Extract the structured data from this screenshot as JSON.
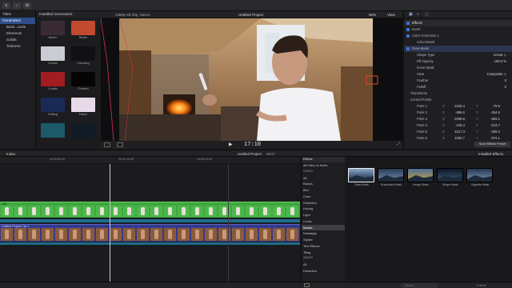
{
  "toolbar": {
    "buttons": [
      "≡",
      "↓",
      "⚙"
    ]
  },
  "libraries": {
    "items": [
      {
        "label": "Titles",
        "selected": false
      },
      {
        "label": "Generators",
        "selected": true
      },
      {
        "label": "Back...unds",
        "selected": false
      },
      {
        "label": "Elements",
        "selected": false
      },
      {
        "label": "Solids",
        "selected": false
      },
      {
        "label": "Textures",
        "selected": false
      }
    ]
  },
  "browser": {
    "title": "Installed Generators",
    "thumbs": [
      {
        "label": "Bokeh",
        "color": "#3a2a34"
      },
      {
        "label": "Bricks",
        "color": "#c24a2e"
      },
      {
        "label": "Clouds",
        "color": "#c9ccd2"
      },
      {
        "label": "Counting",
        "color": "#111114"
      },
      {
        "label": "Curtain",
        "color": "#a31c22"
      },
      {
        "label": "Custom",
        "color": "#050506"
      },
      {
        "label": "Drifting",
        "color": "#1a2a55"
      },
      {
        "label": "Fabric",
        "color": "#e6d9e8"
      },
      {
        "label": "",
        "color": "#1c5a6a"
      },
      {
        "label": "",
        "color": "#121a25"
      }
    ]
  },
  "viewer": {
    "format": "1080p HD 30p, Stereo",
    "project": "Untitled Project",
    "zoom": "50%",
    "view_label": "View",
    "timecode": "17:10"
  },
  "inspector": {
    "sections": [
      {
        "label": "Effects",
        "kind": "head"
      },
      {
        "label": "Invert",
        "kind": "check"
      },
      {
        "label": "Color Correction 1",
        "kind": "check"
      },
      {
        "label": "Color Board",
        "kind": "row",
        "value": ""
      },
      {
        "label": "Draw Mask",
        "kind": "check-sel"
      },
      {
        "label": "Shape Type",
        "kind": "row",
        "value": "Linear ◇"
      },
      {
        "label": "Fill Opacity",
        "kind": "row",
        "value": "100.0 %"
      },
      {
        "label": "Invert Mask",
        "kind": "row",
        "value": ""
      },
      {
        "label": "View",
        "kind": "row",
        "value": "Composite ◇"
      },
      {
        "label": "Feather",
        "kind": "row",
        "value": "0"
      },
      {
        "label": "Falloff",
        "kind": "row",
        "value": "0"
      },
      {
        "label": "Transforms",
        "kind": "sub"
      },
      {
        "label": "Control Points",
        "kind": "sub"
      }
    ],
    "points": [
      {
        "label": "Point 1",
        "x": "-1028.4",
        "y": "-76.6"
      },
      {
        "label": "Point 2",
        "x": "-886.5",
        "y": "-354.6"
      },
      {
        "label": "Point 3",
        "x": "-1096.8",
        "y": "-583.1"
      },
      {
        "label": "Point 4",
        "x": "-245.4",
        "y": "-613.7"
      },
      {
        "label": "Point 5",
        "x": "1017.3",
        "y": "-608.2"
      },
      {
        "label": "Point 6",
        "x": "1062.7",
        "y": "-574.1"
      }
    ],
    "axis_x": "X",
    "axis_y": "Y",
    "save_preset": "Save Effects Preset"
  },
  "timeline_header": {
    "index": "Index",
    "project": "Untitled Project",
    "duration": "38:27",
    "effects_label": "Effects",
    "installed": "Installed Effects"
  },
  "ruler": {
    "labels": [
      "00:00:00:00",
      "00:00:10:00",
      "00:00:20:00"
    ]
  },
  "tracks": {
    "top_clip": "Clip",
    "bottom_clip": "Untitled Project Clip 1"
  },
  "effects": {
    "categories": [
      {
        "label": "All Video & Audio",
        "kind": "row"
      },
      {
        "label": "VIDEO",
        "kind": "head"
      },
      {
        "label": "All",
        "kind": "row"
      },
      {
        "label": "Basics",
        "kind": "row"
      },
      {
        "label": "Blur",
        "kind": "row"
      },
      {
        "label": "Color",
        "kind": "row"
      },
      {
        "label": "Distortion",
        "kind": "row"
      },
      {
        "label": "Keying",
        "kind": "row"
      },
      {
        "label": "Light",
        "kind": "row"
      },
      {
        "label": "Looks",
        "kind": "row"
      },
      {
        "label": "Masks",
        "kind": "sel"
      },
      {
        "label": "Nostalgia",
        "kind": "row"
      },
      {
        "label": "Stylize",
        "kind": "row"
      },
      {
        "label": "Text Effects",
        "kind": "row"
      },
      {
        "label": "Tiling",
        "kind": "row"
      },
      {
        "label": "AUDIO",
        "kind": "head"
      },
      {
        "label": "All",
        "kind": "row"
      },
      {
        "label": "Distortion",
        "kind": "row"
      }
    ],
    "items": [
      {
        "label": "Draw Mask",
        "c1": "#0d1b33",
        "c2": "#8aa7c8"
      },
      {
        "label": "Graduated Mask",
        "c1": "#6f8fb3",
        "c2": "#2a3a52"
      },
      {
        "label": "Image Mask",
        "c1": "#c9a23a",
        "c2": "#4a6d9a"
      },
      {
        "label": "Shape Mask",
        "c1": "#3d5a7a",
        "c2": "#0e1626"
      },
      {
        "label": "Vignette Mask",
        "c1": "#7f99b8",
        "c2": "#243650"
      }
    ],
    "search_placeholder": "Search",
    "item_count": "5 items"
  }
}
